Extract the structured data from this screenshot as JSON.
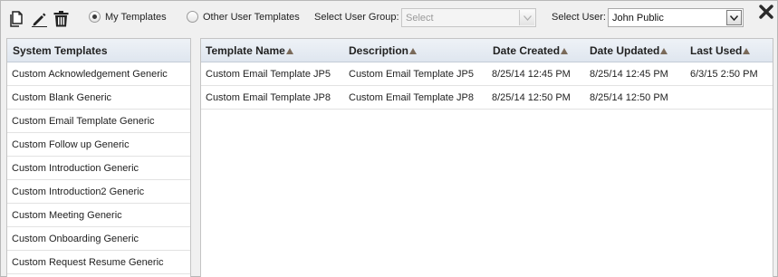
{
  "toolbar": {
    "icons": [
      "copy-icon",
      "edit-icon",
      "trash-icon"
    ],
    "radio_my": "My Templates",
    "radio_other": "Other User Templates",
    "user_group_label": "Select User Group:",
    "user_group_value": "Select",
    "user_label": "Select User:",
    "user_value": "John Public",
    "selected_radio": "My Templates"
  },
  "system_templates": {
    "header": "System Templates",
    "items": [
      "Custom Acknowledgement Generic",
      "Custom Blank Generic",
      "Custom Email Template Generic",
      "Custom Follow up Generic",
      "Custom Introduction Generic",
      "Custom Introduction2 Generic",
      "Custom Meeting Generic",
      "Custom Onboarding Generic",
      "Custom Request Resume Generic"
    ]
  },
  "templates_table": {
    "columns": [
      "Template Name",
      "Description",
      "Date Created",
      "Date Updated",
      "Last Used"
    ],
    "rows": [
      [
        "Custom Email Template JP5",
        "Custom Email Template JP5",
        "8/25/14 12:45 PM",
        "8/25/14 12:45 PM",
        "6/3/15 2:50 PM"
      ],
      [
        "Custom Email Template JP8",
        "Custom Email Template JP8",
        "8/25/14 12:50 PM",
        "8/25/14 12:50 PM",
        ""
      ]
    ]
  },
  "colors": {
    "header_bg": "#e4eaf2",
    "sort_arrow": "#7a6a5a"
  }
}
